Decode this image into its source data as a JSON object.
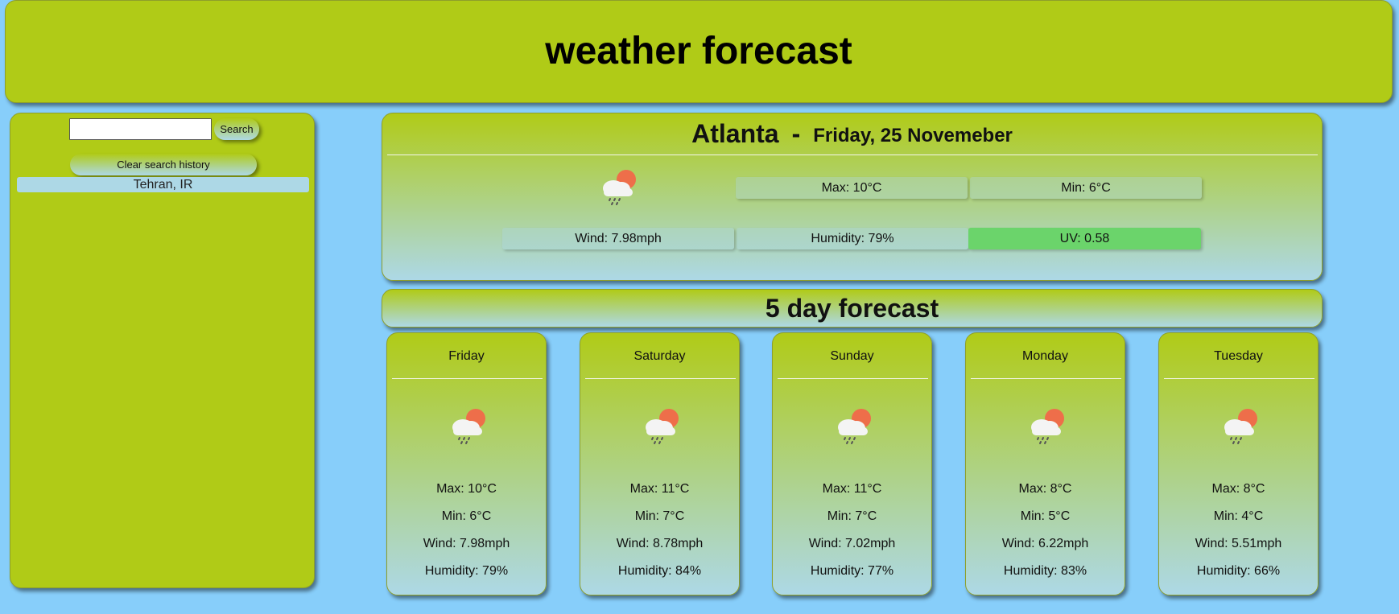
{
  "header": {
    "title": "weather forecast"
  },
  "sidebar": {
    "search": {
      "value": "",
      "placeholder": "",
      "button_label": "Search"
    },
    "clear_label": "Clear search history",
    "history": [
      "Tehran, IR"
    ]
  },
  "current": {
    "city": "Atlanta",
    "separator": "-",
    "date": "Friday, 25 Novemeber",
    "icon": "rain-cloud-sun-icon",
    "max": "Max: 10°C",
    "min": "Min: 6°C",
    "wind": "Wind: 7.98mph",
    "humidity": "Humidity: 79%",
    "uv": "UV: 0.58"
  },
  "forecast": {
    "title": "5 day forecast",
    "days": [
      {
        "day": "Friday",
        "max": "Max: 10°C",
        "min": "Min: 6°C",
        "wind": "Wind: 7.98mph",
        "humidity": "Humidity: 79%"
      },
      {
        "day": "Saturday",
        "max": "Max: 11°C",
        "min": "Min: 7°C",
        "wind": "Wind: 8.78mph",
        "humidity": "Humidity: 84%"
      },
      {
        "day": "Sunday",
        "max": "Max: 11°C",
        "min": "Min: 7°C",
        "wind": "Wind: 7.02mph",
        "humidity": "Humidity: 77%"
      },
      {
        "day": "Monday",
        "max": "Max: 8°C",
        "min": "Min: 5°C",
        "wind": "Wind: 6.22mph",
        "humidity": "Humidity: 83%"
      },
      {
        "day": "Tuesday",
        "max": "Max: 8°C",
        "min": "Min: 4°C",
        "wind": "Wind: 5.51mph",
        "humidity": "Humidity: 66%"
      }
    ]
  },
  "colors": {
    "page_bg": "#87cefa",
    "panel": "#b0cb17",
    "gradient_bottom": "#add8e6",
    "uv_good": "#6bd46b"
  }
}
